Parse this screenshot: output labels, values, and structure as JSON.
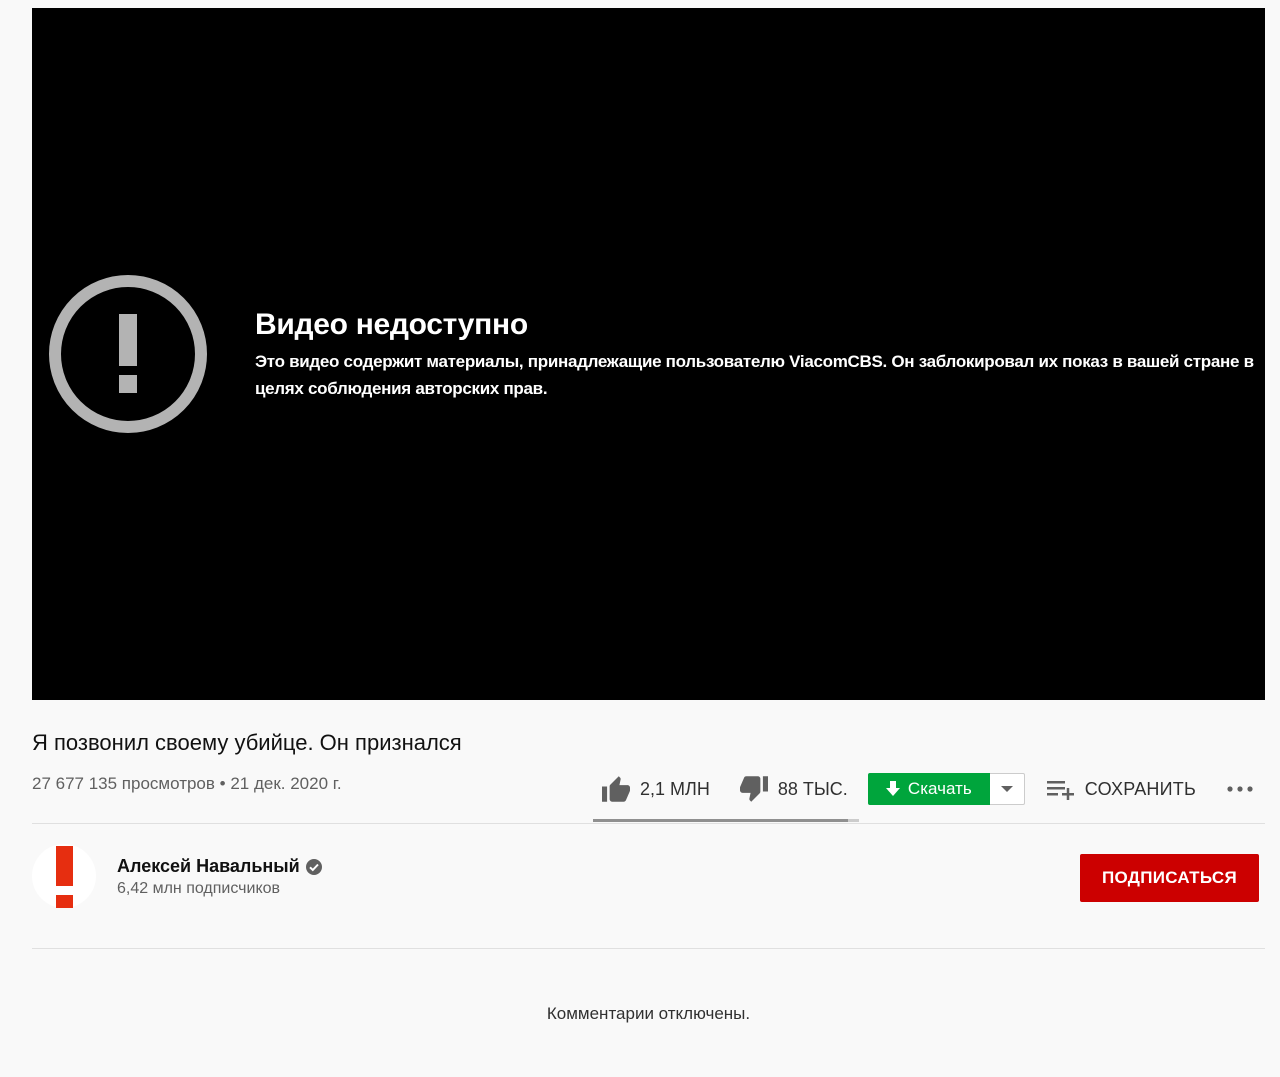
{
  "player": {
    "error_title": "Видео недоступно",
    "error_message": "Это видео содержит материалы, принадлежащие пользователю ViacomCBS. Он заблокировал их показ в вашей стране в целях соблюдения авторских прав.",
    "error_icon": "exclamation-circle-icon"
  },
  "video": {
    "title": "Я позвонил своему убийце. Он признался",
    "views": "27 677 135 просмотров",
    "separator": " • ",
    "date": "21 дек. 2020 г."
  },
  "actions": {
    "likes": "2,1 МЛН",
    "dislikes": "88 ТЫС.",
    "download_label": "Скачать",
    "save_label": "СОХРАНИТЬ",
    "like_ratio": 0.96,
    "download_color": "#00a53c"
  },
  "channel": {
    "name": "Алексей Навальный",
    "subscribers": "6,42 млн подписчиков",
    "subscribe_label": "ПОДПИСАТЬСЯ",
    "subscribe_color": "#cc0000",
    "verified_icon": "verified-check-icon"
  },
  "comments": {
    "status": "Комментарии отключены."
  }
}
